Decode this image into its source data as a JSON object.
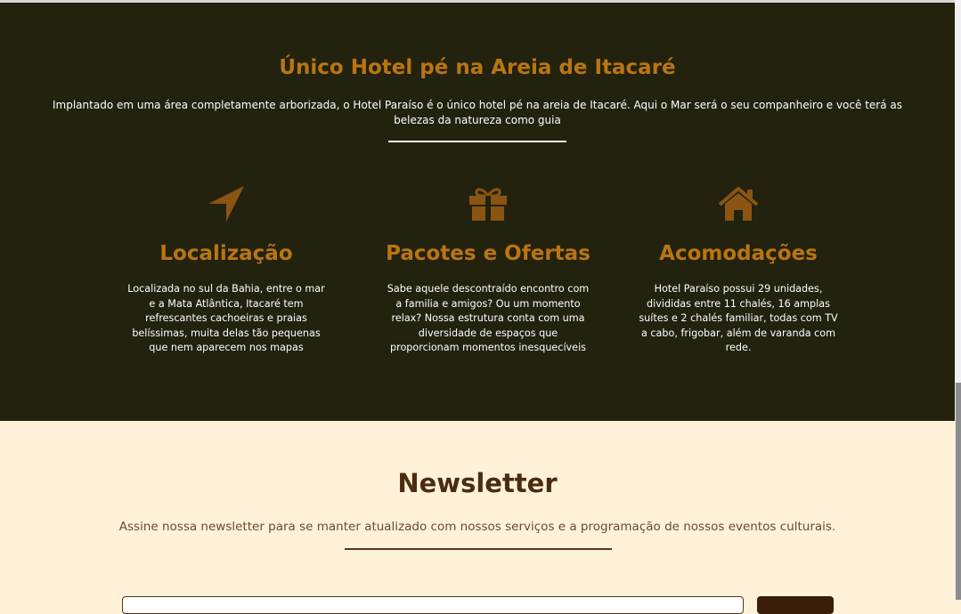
{
  "about": {
    "title": "Único Hotel pé na Areia de Itacaré",
    "description": "Implantado em uma área completamente arborizada, o Hotel Paraíso é o único hotel pé na areia de Itacaré. Aqui o Mar será o seu companheiro e você terá as belezas da natureza como guia"
  },
  "features": [
    {
      "icon": "location-arrow-icon",
      "title": "Localização",
      "text": "Localizada no sul da Bahia, entre o mar e a Mata Atlântica, Itacaré tem refrescantes cachoeiras e praias belíssimas, muita delas tão pequenas que nem aparecem nos mapas"
    },
    {
      "icon": "gift-icon",
      "title": "Pacotes e Ofertas",
      "text": "Sabe aquele descontraído encontro com a familia e amigos? Ou um momento relax? Nossa estrutura conta com uma diversidade de espaços que proporcionam momentos inesquecíveis"
    },
    {
      "icon": "home-icon",
      "title": "Acomodações",
      "text": "Hotel Paraíso possui 29 unidades, divididas entre 11 chalés, 16 amplas suítes e 2 chalés familiar, todas com TV a cabo, frigobar, além de varanda com rede."
    }
  ],
  "newsletter": {
    "title": "Newsletter",
    "text": "Assine nossa newsletter para se manter atualizado com nossos serviços e a programação de nossos eventos culturais."
  },
  "colors": {
    "dark_background": "#22220f",
    "accent": "#b97513",
    "light_background": "#fff2d9",
    "brown": "#4a2c10"
  }
}
